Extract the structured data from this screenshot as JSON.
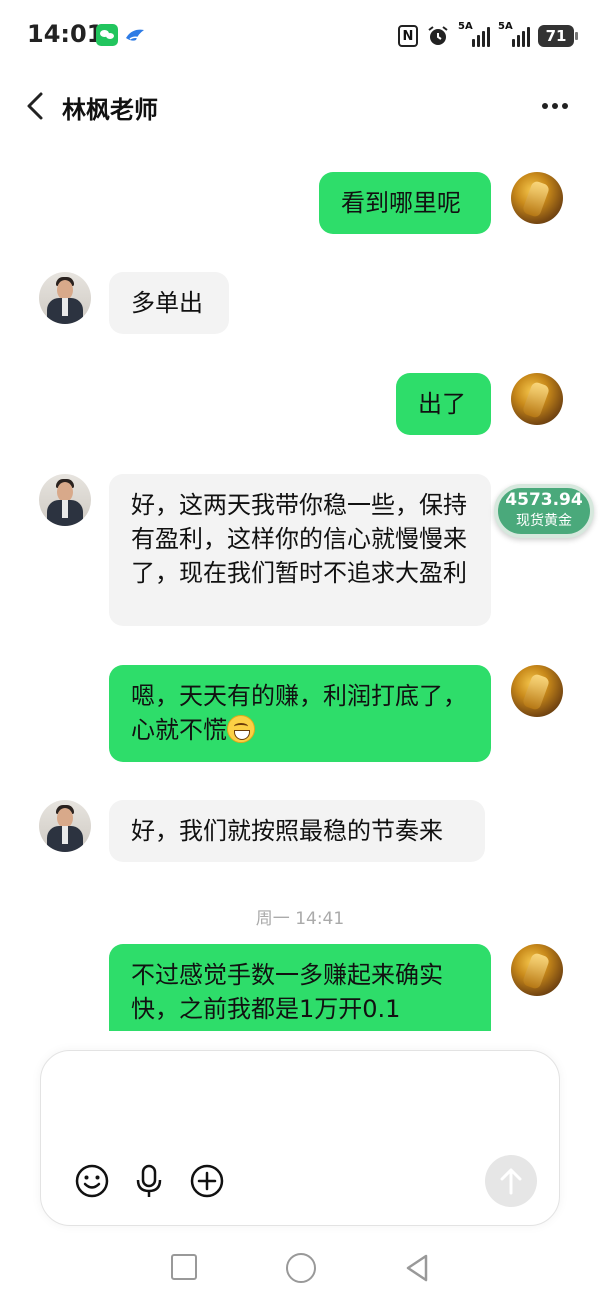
{
  "status_bar": {
    "time": "14:01",
    "nfc": "N",
    "signal1_label": "5A",
    "signal2_label": "5A",
    "battery": "71"
  },
  "header": {
    "title": "林枫老师"
  },
  "messages": [
    {
      "side": "out",
      "text": "看到哪里呢"
    },
    {
      "side": "in",
      "text": "多单出"
    },
    {
      "side": "out",
      "text": "出了"
    },
    {
      "side": "in",
      "text": "好，这两天我带你稳一些，保持有盈利，这样你的信心就慢慢来了，现在我们暂时不追求大盈利"
    },
    {
      "side": "out",
      "text": "嗯，天天有的赚，利润打底了，心就不慌"
    },
    {
      "side": "in",
      "text": "好，我们就按照最稳的节奏来"
    },
    {
      "side": "out",
      "text": "不过感觉手数一多赚起来确实快，之前我都是1万开0.1"
    }
  ],
  "timestamp": "周一 14:41",
  "gold_widget": {
    "price": "4573.94",
    "label": "现货黄金"
  },
  "composer": {
    "placeholder": ""
  },
  "icons": {
    "back": "chevron-left-icon",
    "more": "more-horizontal-icon",
    "emoji": "emoji-icon",
    "voice": "microphone-icon",
    "add": "plus-circle-icon",
    "send": "send-arrow-icon"
  },
  "colors": {
    "outgoing_bubble": "#2edd6a",
    "incoming_bubble": "#f3f3f3",
    "gold_widget": "#4aa97b"
  }
}
